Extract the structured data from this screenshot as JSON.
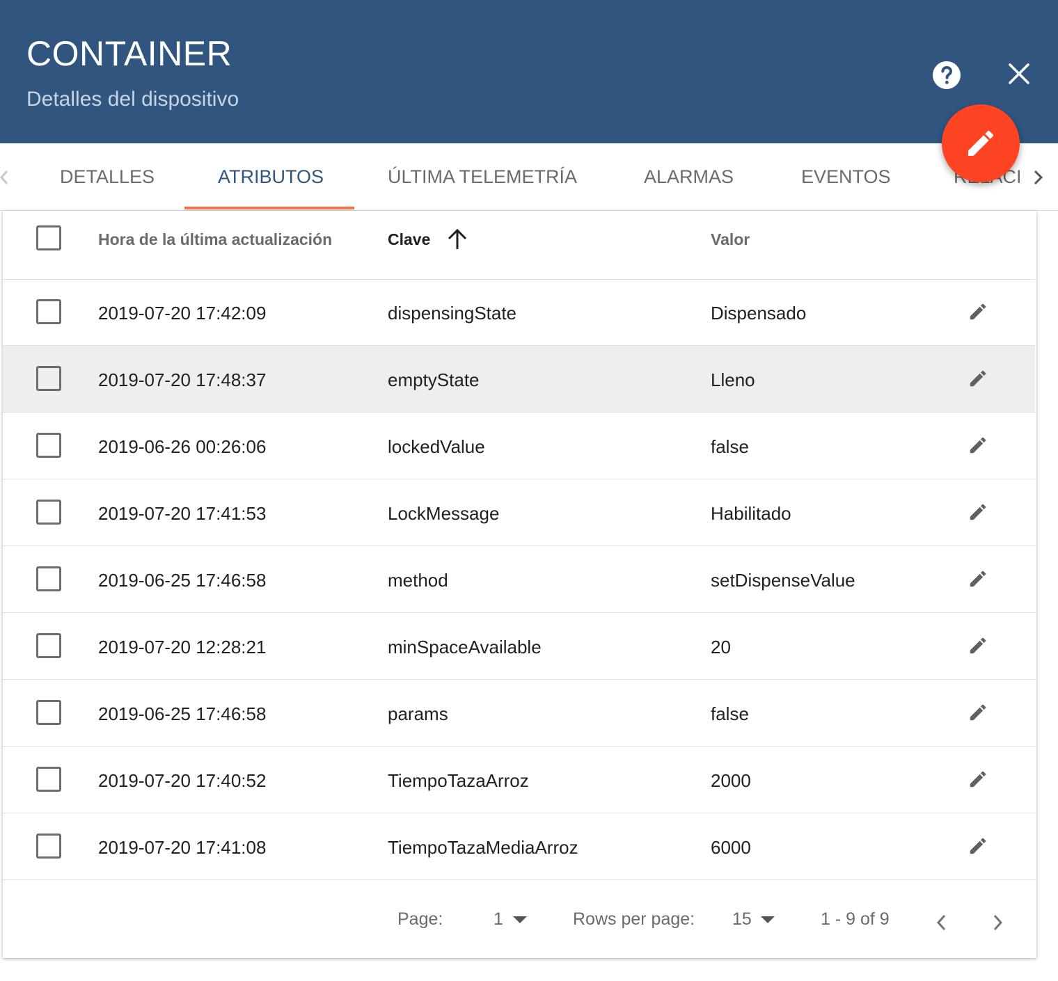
{
  "header": {
    "title": "CONTAINER",
    "subtitle": "Detalles del dispositivo",
    "background_color": "#305680",
    "help_icon": "help-circle-icon",
    "close_icon": "close-icon"
  },
  "fab": {
    "icon": "pencil-icon",
    "color": "#ff4424"
  },
  "tabs": [
    {
      "label": "DETALLES",
      "active": false
    },
    {
      "label": "ATRIBUTOS",
      "active": true
    },
    {
      "label": "ÚLTIMA TELEMETRÍA",
      "active": false
    },
    {
      "label": "ALARMAS",
      "active": false
    },
    {
      "label": "EVENTOS",
      "active": false
    },
    {
      "label": "RELACI",
      "active": false
    }
  ],
  "table": {
    "columns": {
      "time": "Hora de la última actualización",
      "key": "Clave",
      "value": "Valor"
    },
    "sort": {
      "column": "key",
      "direction": "asc",
      "icon": "arrow-up-icon"
    },
    "rows": [
      {
        "time": "2019-07-20 17:42:09",
        "key": "dispensingState",
        "value": "Dispensado"
      },
      {
        "time": "2019-07-20 17:48:37",
        "key": "emptyState",
        "value": "Lleno"
      },
      {
        "time": "2019-06-26 00:26:06",
        "key": "lockedValue",
        "value": "false"
      },
      {
        "time": "2019-07-20 17:41:53",
        "key": "LockMessage",
        "value": "Habilitado"
      },
      {
        "time": "2019-06-25 17:46:58",
        "key": "method",
        "value": "setDispenseValue"
      },
      {
        "time": "2019-07-20 12:28:21",
        "key": "minSpaceAvailable",
        "value": "20"
      },
      {
        "time": "2019-06-25 17:46:58",
        "key": "params",
        "value": "false"
      },
      {
        "time": "2019-07-20 17:40:52",
        "key": "TiempoTazaArroz",
        "value": "2000"
      },
      {
        "time": "2019-07-20 17:41:08",
        "key": "TiempoTazaMediaArroz",
        "value": "6000"
      }
    ]
  },
  "pagination": {
    "page_label": "Page:",
    "page_value": "1",
    "rows_label": "Rows per page:",
    "rows_value": "15",
    "range": "1 - 9 of 9"
  },
  "colors": {
    "accent": "#ff6e40",
    "active_tab": "#305680",
    "row_hover": "#eeeeee"
  }
}
